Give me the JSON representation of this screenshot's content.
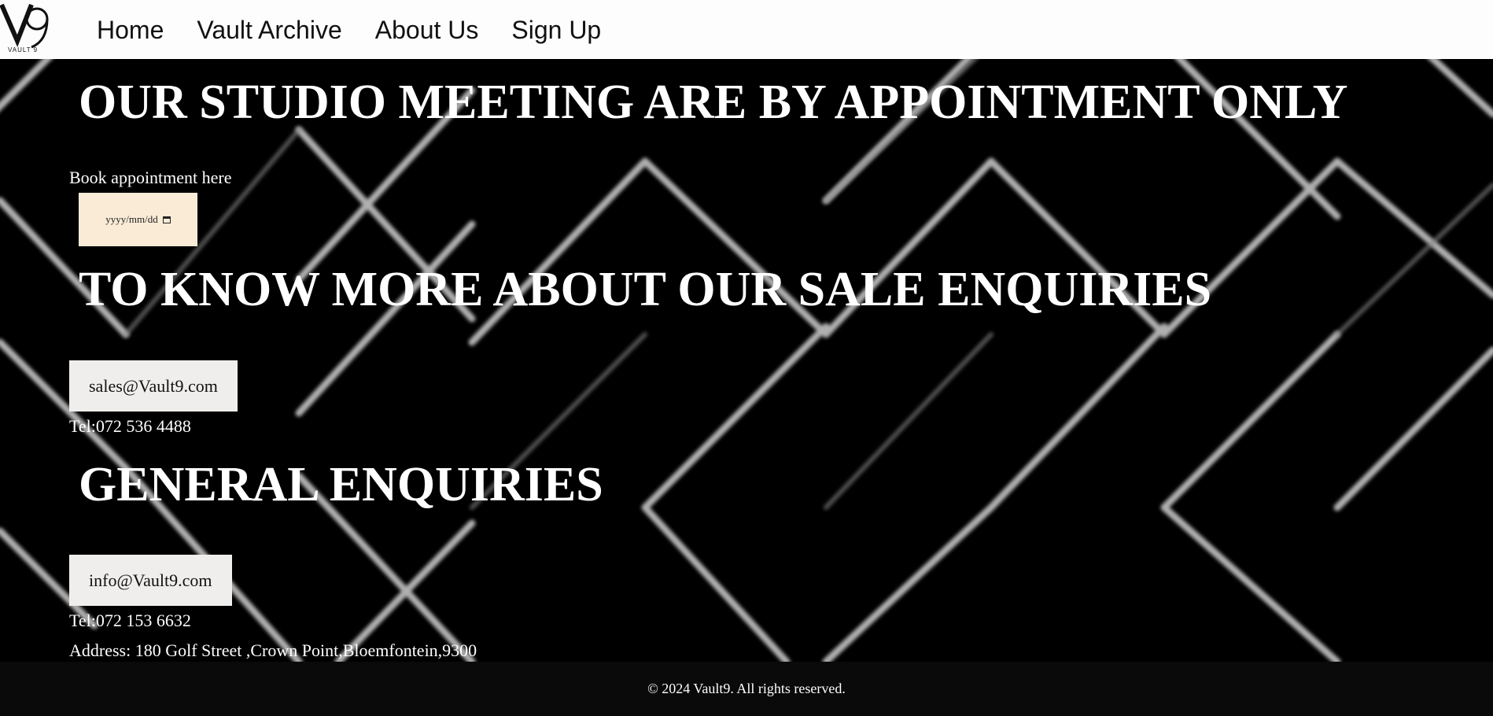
{
  "logo": {
    "text": "VAULT 9"
  },
  "nav": {
    "items": [
      {
        "label": "Home"
      },
      {
        "label": "Vault Archive"
      },
      {
        "label": "About Us"
      },
      {
        "label": "Sign Up"
      }
    ]
  },
  "studio": {
    "heading": "OUR STUDIO MEETING ARE BY APPOINTMENT ONLY",
    "book_label": "Book appointment here",
    "date_placeholder": "yyyy/mm/dd"
  },
  "sales": {
    "heading": "TO KNOW MORE ABOUT OUR SALE ENQUIRIES",
    "email": "sales@Vault9.com",
    "tel": "Tel:072 536 4488"
  },
  "general": {
    "heading": "GENERAL ENQUIRIES",
    "email": "info@Vault9.com",
    "tel": "Tel:072 153 6632",
    "address": "Address: 180 Golf Street ,Crown Point,Bloemfontein,9300"
  },
  "footer": {
    "text": "© 2024 Vault9. All rights reserved."
  },
  "colors": {
    "nav_bg": "#fdfdfd",
    "page_bg": "#000000",
    "date_input_bg": "#faebd7",
    "email_button_bg": "#f0eeec",
    "footer_bg": "#0a0a0a"
  }
}
